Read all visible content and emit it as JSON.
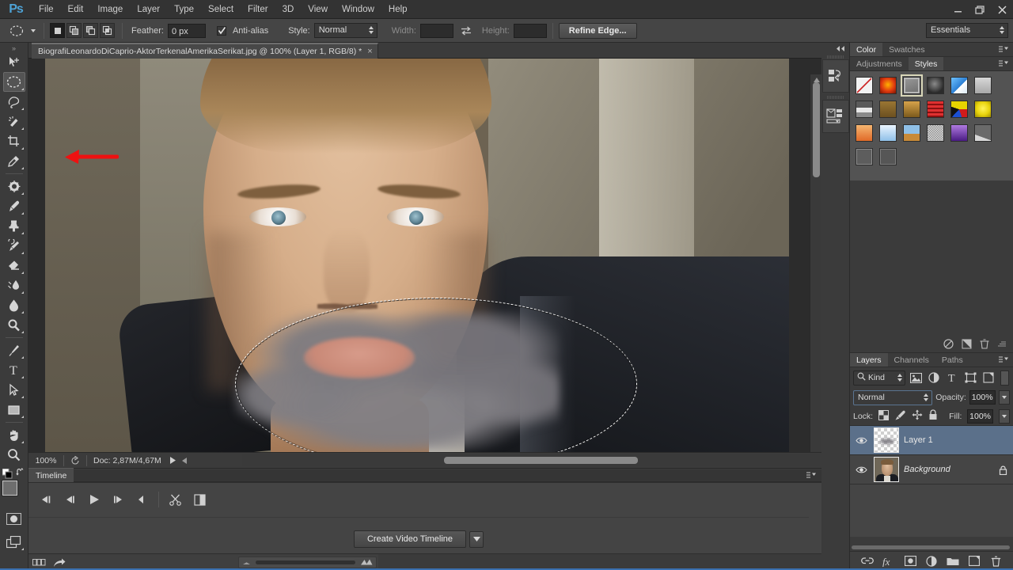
{
  "app": {
    "logo": "Ps",
    "workspace": "Essentials"
  },
  "menubar": {
    "items": [
      "File",
      "Edit",
      "Image",
      "Layer",
      "Type",
      "Select",
      "Filter",
      "3D",
      "View",
      "Window",
      "Help"
    ]
  },
  "window_controls": {
    "minimize": "minimize-icon",
    "restore": "restore-icon",
    "close": "close-icon"
  },
  "options_bar": {
    "tool_icon": "elliptical-marquee-icon",
    "selection_modes": [
      "new-selection",
      "add-to-selection",
      "subtract-from-selection",
      "intersect-with-selection"
    ],
    "active_selection_mode": 0,
    "feather_label": "Feather:",
    "feather_value": "0 px",
    "antialias_label": "Anti-alias",
    "antialias_checked": true,
    "style_label": "Style:",
    "style_value": "Normal",
    "width_label": "Width:",
    "width_value": "",
    "swap_icon": "swap-dimensions-icon",
    "height_label": "Height:",
    "height_value": "",
    "refine_edge_label": "Refine Edge..."
  },
  "toolbar": {
    "tools": [
      {
        "name": "move-tool",
        "selected": false,
        "submenu": false
      },
      {
        "name": "elliptical-marquee-tool",
        "selected": true,
        "submenu": true
      },
      {
        "name": "lasso-tool",
        "selected": false,
        "submenu": true
      },
      {
        "name": "quick-selection-tool",
        "selected": false,
        "submenu": true
      },
      {
        "name": "crop-tool",
        "selected": false,
        "submenu": true
      },
      {
        "name": "eyedropper-tool",
        "selected": false,
        "submenu": true
      },
      {
        "name": "spot-healing-brush-tool",
        "selected": false,
        "submenu": true
      },
      {
        "name": "brush-tool",
        "selected": false,
        "submenu": true
      },
      {
        "name": "clone-stamp-tool",
        "selected": false,
        "submenu": true
      },
      {
        "name": "history-brush-tool",
        "selected": false,
        "submenu": true
      },
      {
        "name": "eraser-tool",
        "selected": false,
        "submenu": true
      },
      {
        "name": "gradient-tool",
        "selected": false,
        "submenu": true
      },
      {
        "name": "blur-tool",
        "selected": false,
        "submenu": true
      },
      {
        "name": "dodge-tool",
        "selected": false,
        "submenu": true
      },
      {
        "name": "pen-tool",
        "selected": false,
        "submenu": true
      },
      {
        "name": "type-tool",
        "selected": false,
        "submenu": true
      },
      {
        "name": "path-selection-tool",
        "selected": false,
        "submenu": true
      },
      {
        "name": "rectangle-tool",
        "selected": false,
        "submenu": true
      },
      {
        "name": "hand-tool",
        "selected": false,
        "submenu": true
      },
      {
        "name": "zoom-tool",
        "selected": false,
        "submenu": false
      }
    ],
    "foreground_color": "#6e6e6e",
    "background_color": "#2b2ae0",
    "quick_mask_icon": "quick-mask-icon",
    "screen_mode_icon": "screen-mode-icon"
  },
  "document": {
    "tab_title": "BiografiLeonardoDiCaprio-AktorTerkenalAmerikaSerikat.jpg @ 100% (Layer 1, RGB/8) *",
    "close_label": "×",
    "zoom_level": "100%",
    "doc_size": "Doc: 2,87M/4,67M",
    "annotation": "red-left-arrow"
  },
  "timeline": {
    "tab_label": "Timeline",
    "controls": [
      "go-to-first-frame",
      "previous-frame",
      "play",
      "next-frame",
      "audio-mute"
    ],
    "edit_controls": [
      "scissors-split-icon",
      "transition-icon"
    ],
    "create_label": "Create Video Timeline",
    "footer_icons": [
      "convert-to-frame-animation-icon",
      "share-icon"
    ],
    "zoom_out_icon": "zoom-out-icon",
    "zoom_in_icon": "zoom-in-icon"
  },
  "dock_strip": {
    "collapse_icon": "collapse-panels-icon",
    "items": [
      "history-panel-icon",
      "properties-panel-icon"
    ]
  },
  "color_panel": {
    "tabs": [
      {
        "label": "Color",
        "active": true
      },
      {
        "label": "Swatches",
        "active": false
      }
    ],
    "menu_icon": "panel-menu-icon"
  },
  "styles_panel": {
    "tabs": [
      {
        "label": "Adjustments",
        "active": false
      },
      {
        "label": "Styles",
        "active": true
      }
    ],
    "menu_icon": "panel-menu-icon",
    "selected_index": 2,
    "swatches": [
      {
        "name": "none-style",
        "color": "#f2f2f2"
      },
      {
        "name": "red-glow-style",
        "color": "#e03a10"
      },
      {
        "name": "basic-drop-shadow-style",
        "color": "#8a8a8a"
      },
      {
        "name": "dark-swirl-style",
        "color": "#3a3a3a"
      },
      {
        "name": "blue-glass-style",
        "color": "#3a8fe0"
      },
      {
        "name": "gray-bevel-style",
        "color": "#c6c6c6"
      },
      {
        "name": "chrome-style",
        "color": "#9a9a9a"
      },
      {
        "name": "bronze-style",
        "color": "#8a6a33"
      },
      {
        "name": "gold-gradient-style",
        "color": "#c08a30"
      },
      {
        "name": "red-stripes-style",
        "color": "#c41f1f"
      },
      {
        "name": "colorful-paint-style",
        "color": "#d8c020"
      },
      {
        "name": "yellow-glass-style",
        "color": "#e8d30c"
      },
      {
        "name": "sunset-style",
        "color": "#e08a4a"
      },
      {
        "name": "blue-gel-style",
        "color": "#8fc0e8"
      },
      {
        "name": "horizon-style",
        "color": "#4a7ab0"
      },
      {
        "name": "noise-texture-style",
        "color": "#e8e8e8"
      },
      {
        "name": "purple-gradient-style",
        "color": "#8a4ac0"
      },
      {
        "name": "paper-curl-style",
        "color": "#d8d8d8"
      },
      {
        "name": "basic-button-style",
        "color": "#6a6a6a"
      },
      {
        "name": "soft-button-style",
        "color": "#5c5c5c"
      }
    ]
  },
  "properties_row": {
    "icons": [
      "no-entry-icon",
      "clip-to-layer-icon",
      "delete-icon",
      "collapse-icon"
    ]
  },
  "layers_panel": {
    "tabs": [
      {
        "label": "Layers",
        "active": true
      },
      {
        "label": "Channels",
        "active": false
      },
      {
        "label": "Paths",
        "active": false
      }
    ],
    "menu_icon": "panel-menu-icon",
    "filter": {
      "search_icon": "search-icon",
      "kind_label": "Kind",
      "filter_icons": [
        "filter-pixel-icon",
        "filter-adjustment-icon",
        "filter-type-icon",
        "filter-shape-icon",
        "filter-smart-object-icon"
      ],
      "toggle_name": "filter-enable-toggle"
    },
    "blend_mode": "Normal",
    "opacity_label": "Opacity:",
    "opacity_value": "100%",
    "lock_label": "Lock:",
    "lock_icons": [
      "lock-transparent-pixels-icon",
      "lock-image-pixels-icon",
      "lock-position-icon",
      "lock-all-icon"
    ],
    "fill_label": "Fill:",
    "fill_value": "100%",
    "layers": [
      {
        "name": "Layer 1",
        "visible": true,
        "selected": true,
        "locked": false,
        "italic": false,
        "thumb": "transparent-smudge"
      },
      {
        "name": "Background",
        "visible": true,
        "selected": false,
        "locked": true,
        "italic": true,
        "thumb": "portrait-photo"
      }
    ],
    "bottom_icons": [
      "link-layers-icon",
      "add-layer-style-icon",
      "add-layer-mask-icon",
      "new-fill-adjustment-icon",
      "new-group-icon",
      "new-layer-icon",
      "delete-layer-icon"
    ]
  }
}
